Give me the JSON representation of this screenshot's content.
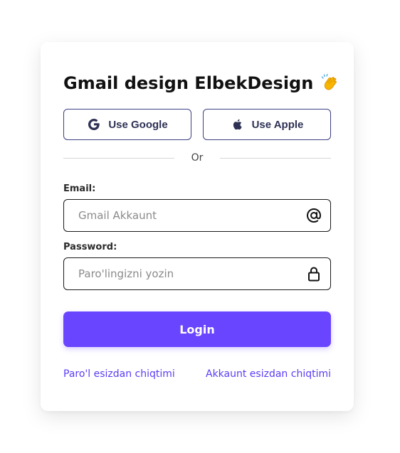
{
  "card": {
    "title": "Gmail design ElbekDesign",
    "title_emoji_icon": "clapping-hands-icon"
  },
  "social": {
    "google_label": "Use Google",
    "google_icon": "google-icon",
    "apple_label": "Use Apple",
    "apple_icon": "apple-icon"
  },
  "divider": {
    "text": "Or"
  },
  "email": {
    "label": "Email:",
    "placeholder": "Gmail Akkaunt",
    "value": "",
    "icon": "at-sign-icon"
  },
  "password": {
    "label": "Password:",
    "placeholder": "Paro'lingizni yozin",
    "value": "",
    "icon": "lock-icon"
  },
  "login": {
    "label": "Login"
  },
  "links": {
    "forgot_password": "Paro'l esizdan chiqtimi",
    "forgot_account": "Akkaunt esizdan chiqtimi"
  },
  "colors": {
    "accent": "#6a45ff",
    "link": "#5b3cf5",
    "social_border": "#3b3f82",
    "card_bg": "#ffffff"
  }
}
